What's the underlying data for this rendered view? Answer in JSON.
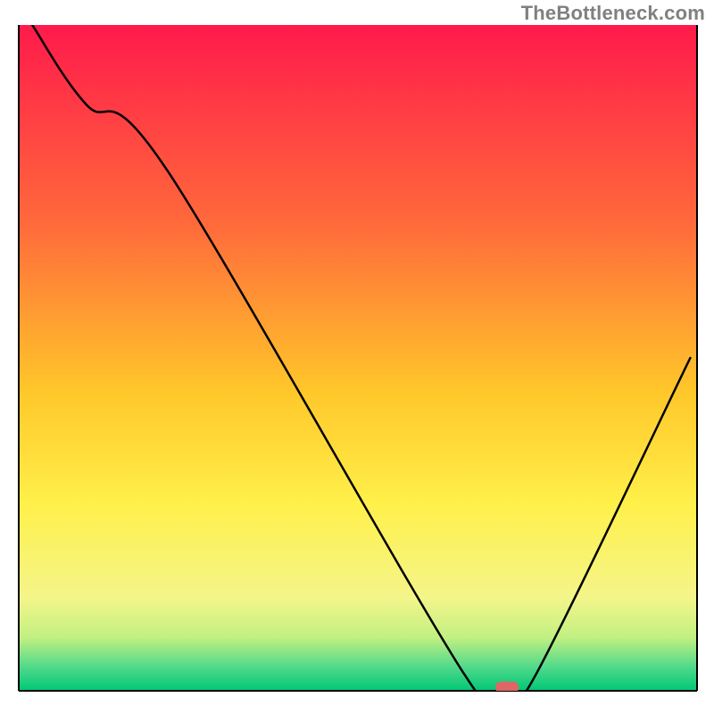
{
  "watermark": "TheBottleneck.com",
  "chart_data": {
    "type": "line",
    "title": "",
    "xlabel": "",
    "ylabel": "",
    "xlim": [
      0,
      100
    ],
    "ylim": [
      0,
      100
    ],
    "x": [
      2,
      10,
      22,
      66,
      72,
      76,
      99
    ],
    "values": [
      100,
      88,
      78,
      2,
      0.5,
      2,
      50
    ],
    "marker": {
      "x": 72,
      "y": 0.5,
      "color": "#e06666"
    },
    "background_gradient": {
      "stops": [
        {
          "offset": 0.0,
          "color": "#ff1a4b"
        },
        {
          "offset": 0.3,
          "color": "#ff6a3b"
        },
        {
          "offset": 0.55,
          "color": "#ffc72a"
        },
        {
          "offset": 0.72,
          "color": "#fff04a"
        },
        {
          "offset": 0.86,
          "color": "#f4f58a"
        },
        {
          "offset": 0.92,
          "color": "#c2f082"
        },
        {
          "offset": 0.965,
          "color": "#4fd98a"
        },
        {
          "offset": 1.0,
          "color": "#00c776"
        }
      ]
    },
    "axis_color": "#000000",
    "curve_color": "#000000"
  }
}
